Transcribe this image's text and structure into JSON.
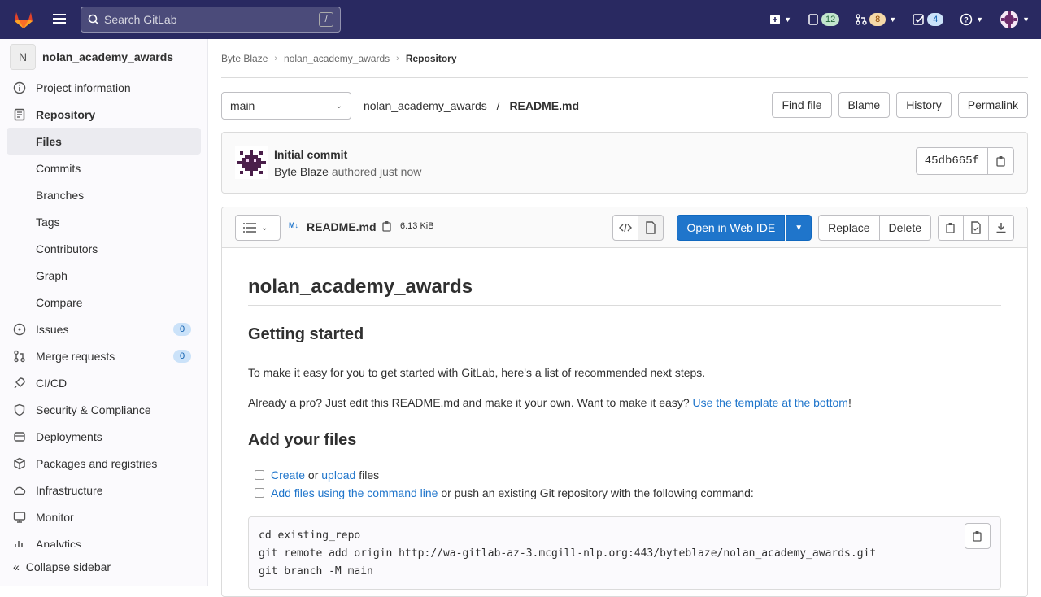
{
  "topnav": {
    "search_placeholder": "Search GitLab",
    "search_shortcut": "/",
    "issues_count": "12",
    "mr_count": "8",
    "todos_count": "4"
  },
  "sidebar": {
    "project_initial": "N",
    "project_name": "nolan_academy_awards",
    "items": [
      {
        "label": "Project information"
      },
      {
        "label": "Repository"
      },
      {
        "label": "Files"
      },
      {
        "label": "Commits"
      },
      {
        "label": "Branches"
      },
      {
        "label": "Tags"
      },
      {
        "label": "Contributors"
      },
      {
        "label": "Graph"
      },
      {
        "label": "Compare"
      },
      {
        "label": "Issues",
        "count": "0"
      },
      {
        "label": "Merge requests",
        "count": "0"
      },
      {
        "label": "CI/CD"
      },
      {
        "label": "Security & Compliance"
      },
      {
        "label": "Deployments"
      },
      {
        "label": "Packages and registries"
      },
      {
        "label": "Infrastructure"
      },
      {
        "label": "Monitor"
      },
      {
        "label": "Analytics"
      }
    ],
    "collapse_label": "Collapse sidebar"
  },
  "breadcrumb": {
    "items": [
      "Byte Blaze",
      "nolan_academy_awards",
      "Repository"
    ]
  },
  "tree": {
    "branch": "main",
    "path_project": "nolan_academy_awards",
    "path_sep": "/",
    "path_file": "README.md",
    "buttons": [
      "Find file",
      "Blame",
      "History",
      "Permalink"
    ]
  },
  "commit": {
    "title": "Initial commit",
    "author": "Byte Blaze",
    "meta": "authored just now",
    "sha": "45db665f"
  },
  "file": {
    "md_badge": "M↓",
    "name": "README.md",
    "size": "6.13 KiB",
    "open_ide": "Open in Web IDE",
    "replace": "Replace",
    "delete": "Delete"
  },
  "readme": {
    "h1": "nolan_academy_awards",
    "h2_getting_started": "Getting started",
    "p1": "To make it easy for you to get started with GitLab, here's a list of recommended next steps.",
    "p2_prefix": "Already a pro? Just edit this README.md and make it your own. Want to make it easy? ",
    "p2_link": "Use the template at the bottom",
    "p2_suffix": "!",
    "h2_add_files": "Add your files",
    "task1_link1": "Create",
    "task1_mid": " or ",
    "task1_link2": "upload",
    "task1_suffix": " files",
    "task2_link": "Add files using the command line",
    "task2_suffix": " or push an existing Git repository with the following command:",
    "code_lines": [
      "cd existing_repo",
      "git remote add origin http://wa-gitlab-az-3.mcgill-nlp.org:443/byteblaze/nolan_academy_awards.git",
      "git branch -M main"
    ]
  }
}
